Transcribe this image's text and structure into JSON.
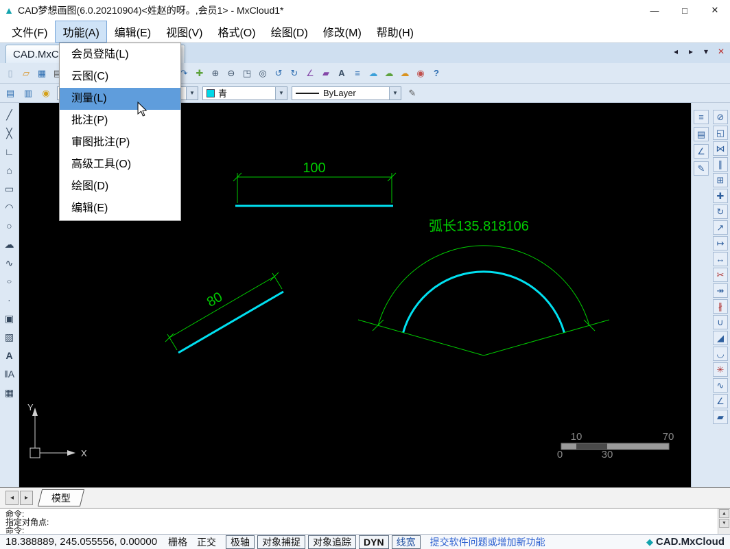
{
  "window": {
    "title": "CAD梦想画图(6.0.20210904)<姓赵的呀。,会员1> - MxCloud1*",
    "controls": {
      "minimize": "—",
      "maximize": "□",
      "close": "✕"
    }
  },
  "menubar": {
    "items": [
      "文件(F)",
      "功能(A)",
      "编辑(E)",
      "视图(V)",
      "格式(O)",
      "绘图(D)",
      "修改(M)",
      "帮助(H)"
    ]
  },
  "dropdown": {
    "items": [
      "会员登陆(L)",
      "云图(C)",
      "测量(L)",
      "批注(P)",
      "审图批注(P)",
      "高级工具(O)",
      "绘图(D)",
      "编辑(E)"
    ],
    "highlighted": "测量(L)"
  },
  "tabbar": {
    "tab": "CAD.MxCloud1*",
    "controls": [
      "◂",
      "▸",
      "▾",
      "✕"
    ]
  },
  "toolbar1": {
    "icons": [
      {
        "name": "new-file-icon",
        "glyph": "▯"
      },
      {
        "name": "open-folder-icon",
        "glyph": "▱"
      },
      {
        "name": "save-icon",
        "glyph": "▦"
      },
      {
        "name": "print-icon",
        "glyph": "▤"
      },
      {
        "name": "print-preview-icon",
        "glyph": "◫"
      },
      {
        "name": "export-icon",
        "glyph": "⇨"
      },
      {
        "name": "cut-icon",
        "glyph": "✂"
      },
      {
        "name": "copy-icon",
        "glyph": "◱"
      },
      {
        "name": "paste-icon",
        "glyph": "▤"
      },
      {
        "name": "match-properties-icon",
        "glyph": "✒"
      },
      {
        "name": "undo-icon",
        "glyph": "↶"
      },
      {
        "name": "redo-icon",
        "glyph": "↷"
      },
      {
        "name": "pan-icon",
        "glyph": "✚"
      },
      {
        "name": "zoom-in-icon",
        "glyph": "⊕"
      },
      {
        "name": "zoom-out-icon",
        "glyph": "⊖"
      },
      {
        "name": "zoom-window-icon",
        "glyph": "◳"
      },
      {
        "name": "zoom-extents-icon",
        "glyph": "◎"
      },
      {
        "name": "zoom-previous-icon",
        "glyph": "↺"
      },
      {
        "name": "regen-icon",
        "glyph": "↻"
      },
      {
        "name": "measure-angle-icon",
        "glyph": "∠"
      },
      {
        "name": "measure-area-icon",
        "glyph": "▰"
      },
      {
        "name": "text-tool-icon",
        "glyph": "A"
      },
      {
        "name": "layers-icon",
        "glyph": "≡"
      },
      {
        "name": "cloud-save-icon",
        "glyph": "☁"
      },
      {
        "name": "cloud-open-icon",
        "glyph": "☁"
      },
      {
        "name": "cloud-share-icon",
        "glyph": "☁"
      },
      {
        "name": "member-icon",
        "glyph": "◉"
      },
      {
        "name": "help-icon",
        "glyph": "?"
      }
    ]
  },
  "toolbar2": {
    "icons": [
      {
        "name": "layer-manager-icon",
        "glyph": "▤"
      },
      {
        "name": "layer-states-icon",
        "glyph": "▥"
      },
      {
        "name": "lock-layer-icon",
        "glyph": "◉"
      },
      {
        "name": "lineweight-pencil-icon",
        "glyph": "✎"
      }
    ],
    "layer_combo": {
      "value": ""
    },
    "color_combo": {
      "value": "青",
      "swatch_color": "#00d8e8"
    },
    "linetype_combo": {
      "value": "ByLayer"
    }
  },
  "left_toolbar": {
    "icons": [
      {
        "name": "line-icon",
        "glyph": "╱"
      },
      {
        "name": "construction-line-icon",
        "glyph": "╳"
      },
      {
        "name": "polyline-icon",
        "glyph": "∟"
      },
      {
        "name": "polygon-icon",
        "glyph": "⌂"
      },
      {
        "name": "rectangle-icon",
        "glyph": "▭"
      },
      {
        "name": "arc-icon",
        "glyph": "◠"
      },
      {
        "name": "circle-icon",
        "glyph": "○"
      },
      {
        "name": "revcloud-icon",
        "glyph": "☁"
      },
      {
        "name": "spline-icon",
        "glyph": "∿"
      },
      {
        "name": "ellipse-icon",
        "glyph": "○"
      },
      {
        "name": "point-icon",
        "glyph": "∙"
      },
      {
        "name": "insert-block-icon",
        "glyph": "▣"
      },
      {
        "name": "image-icon",
        "glyph": "▨"
      },
      {
        "name": "text-icon",
        "glyph": "A"
      },
      {
        "name": "mtext-icon",
        "glyph": "‖A"
      },
      {
        "name": "hatch-icon",
        "glyph": "▦"
      }
    ]
  },
  "right_toolbar": {
    "inner": [
      {
        "name": "draw-order-icon",
        "glyph": "≡"
      },
      {
        "name": "properties-panel-icon",
        "glyph": "▤"
      },
      {
        "name": "quick-measure-icon",
        "glyph": "∠"
      },
      {
        "name": "edit-pencil-icon",
        "glyph": "✎"
      }
    ],
    "outer": [
      {
        "name": "erase-icon",
        "glyph": "⊘"
      },
      {
        "name": "copy-object-icon",
        "glyph": "◱"
      },
      {
        "name": "mirror-icon",
        "glyph": "⋈"
      },
      {
        "name": "offset-icon",
        "glyph": "∥"
      },
      {
        "name": "array-icon",
        "glyph": "⊞"
      },
      {
        "name": "move-icon",
        "glyph": "✚"
      },
      {
        "name": "rotate-icon",
        "glyph": "↻"
      },
      {
        "name": "scale-icon",
        "glyph": "↗"
      },
      {
        "name": "stretch-icon",
        "glyph": "↦"
      },
      {
        "name": "lengthen-icon",
        "glyph": "↔"
      },
      {
        "name": "trim-icon",
        "glyph": "✂"
      },
      {
        "name": "extend-icon",
        "glyph": "↠"
      },
      {
        "name": "break-icon",
        "glyph": "∦"
      },
      {
        "name": "join-icon",
        "glyph": "∪"
      },
      {
        "name": "chamfer-icon",
        "glyph": "◢"
      },
      {
        "name": "fillet-icon",
        "glyph": "◡"
      },
      {
        "name": "explode-icon",
        "glyph": "✳"
      },
      {
        "name": "pedit-icon",
        "glyph": "∿"
      },
      {
        "name": "distance-icon",
        "glyph": "∠"
      },
      {
        "name": "area-icon",
        "glyph": "▰"
      }
    ]
  },
  "canvas": {
    "dim100": "100",
    "dim80": "80",
    "arc_label": "弧长135.818106",
    "ucs": {
      "x": "X",
      "y": "Y"
    },
    "scalebar": {
      "n10": "10",
      "n70": "70",
      "n0": "0",
      "n30": "30"
    },
    "colors": {
      "entity_cyan": "#00e0f0",
      "dimension_green": "#00cc00"
    }
  },
  "model_bar": {
    "tab": "模型",
    "nav_left": "◂",
    "nav_right": "▸"
  },
  "command": {
    "lines": [
      "命令:",
      "指定对角点:",
      "命令:"
    ],
    "scroll_up": "▲",
    "scroll_down": "▼"
  },
  "statusbar": {
    "coords": "18.388889, 245.055556, 0.00000",
    "grid": "栅格",
    "ortho": "正交",
    "toggles": [
      "极轴",
      "对象捕捉",
      "对象追踪",
      "DYN",
      "线宽"
    ],
    "link": "提交软件问题或增加新功能",
    "brand": "CAD.MxCloud"
  }
}
